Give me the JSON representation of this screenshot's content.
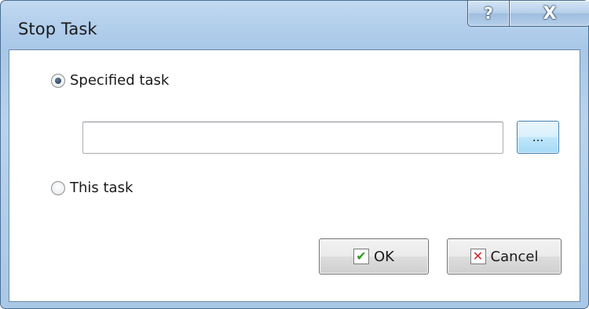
{
  "window": {
    "title": "Stop Task"
  },
  "caption_buttons": {
    "help_label": "?",
    "close_label": "X"
  },
  "options": {
    "specified_task_label": "Specified task",
    "specified_task_selected": true,
    "task_value": "",
    "browse_label": "...",
    "this_task_label": "This task",
    "this_task_selected": false
  },
  "buttons": {
    "ok_label": "OK",
    "cancel_label": "Cancel"
  },
  "icons": {
    "ok_icon": "check-icon",
    "cancel_icon": "x-icon",
    "check_color": "#2f9a21",
    "x_color": "#d92222"
  }
}
